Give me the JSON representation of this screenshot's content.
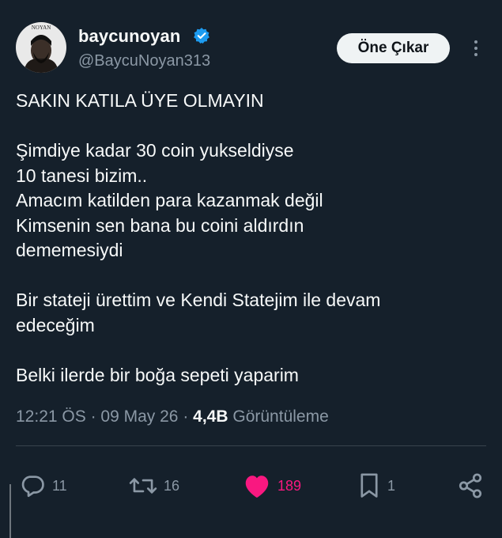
{
  "colors": {
    "background": "#15202b",
    "text_primary": "#f7f9f9",
    "text_secondary": "#8b98a5",
    "verified_blue": "#1d9bf0",
    "like_pink": "#f91880",
    "button_bg": "#eff3f4"
  },
  "author": {
    "display_name": "baycunoyan",
    "handle": "@BaycuNoyan313",
    "avatar_text": "NOYAN",
    "verified_icon": "verified-badge-icon"
  },
  "header": {
    "subscribe_label": "Öne Çıkar",
    "more_icon": "more-vertical-icon"
  },
  "tweet": {
    "paragraphs": [
      "SAKIN KATILA ÜYE OLMAYIN",
      "Şimdiye kadar 30 coin yukseldiyse\n10 tanesi bizim..\nAmacım katilden para kazanmak değil\nKimsenin sen bana bu coini aldırdın\ndememesiydi",
      "Bir stateji ürettim ve Kendi Statejim ile devam\nedeceğim",
      "Belki ilerde bir boğa sepeti yaparim"
    ]
  },
  "meta": {
    "time": "12:21 ÖS",
    "separator": "·",
    "date": "09 May 26",
    "views_count": "4,4B",
    "views_label": "Görüntüleme"
  },
  "actions": {
    "reply": {
      "icon": "reply-icon",
      "count": "11"
    },
    "retweet": {
      "icon": "retweet-icon",
      "count": "16"
    },
    "like": {
      "icon": "heart-icon",
      "count": "189"
    },
    "bookmark": {
      "icon": "bookmark-icon",
      "count": "1"
    },
    "share": {
      "icon": "share-icon"
    }
  }
}
